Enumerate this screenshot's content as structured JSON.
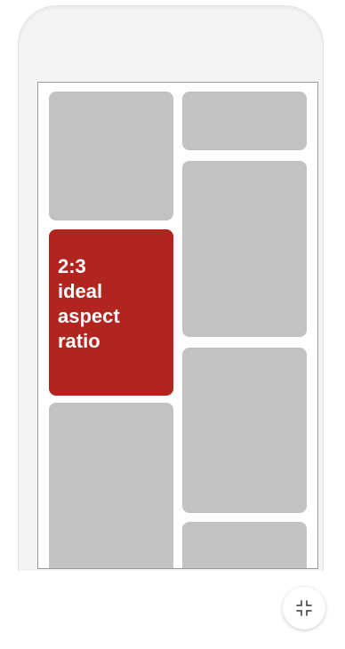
{
  "featured_tile": {
    "label_lines": [
      "2:3",
      "ideal",
      "aspect",
      "ratio"
    ],
    "color": "#b2251e"
  },
  "placeholder_color": "#c2c2c2",
  "collapse_button": {
    "icon": "collapse-arrows-icon"
  }
}
